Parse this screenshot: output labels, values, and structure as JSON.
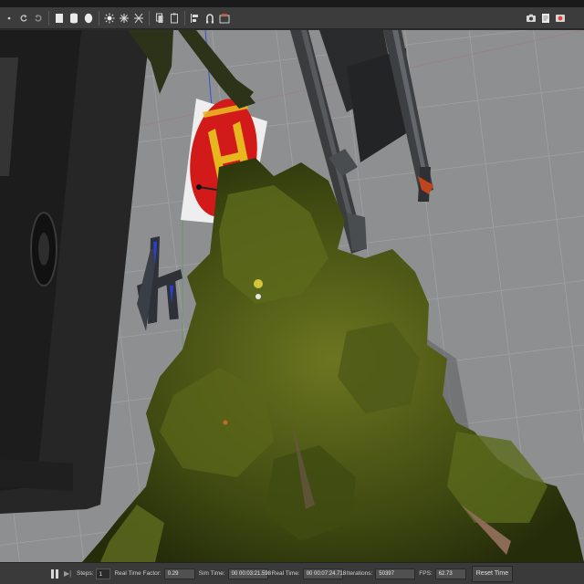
{
  "toolbar": {
    "left_tools": [
      "select-arrow-icon",
      "redo-icon",
      "box-shape-icon",
      "cylinder-shape-icon",
      "sphere-shape-icon",
      "sun-light-icon",
      "point-light-icon",
      "spot-light-icon",
      "copy-icon",
      "paste-icon",
      "align-icon",
      "snap-icon",
      "change-view-icon"
    ],
    "right_tools": [
      "screenshot-icon",
      "log-icon",
      "record-video-icon"
    ],
    "record_color": "#e0452f"
  },
  "status": {
    "steps_label": "Steps:",
    "steps_value": "1",
    "real_time_factor_label": "Real Time Factor:",
    "real_time_factor_value": "0.29",
    "sim_time_label": "Sim Time:",
    "sim_time_value": "00 00:03:21.598",
    "real_time_label": "Real Time:",
    "real_time_value": "00 00:07:24.718",
    "iterations_label": "Iterations:",
    "iterations_value": "50397",
    "fps_label": "FPS:",
    "fps_value": "62.73",
    "reset_label": "Reset Time"
  },
  "scene": {
    "ground_color": "#8e8f90",
    "grid_color": "#a3a4a5",
    "helipad_color": "#d31a1a",
    "helipad_letter_color": "#e7b71f",
    "foliage_color": "#4f5a17"
  }
}
